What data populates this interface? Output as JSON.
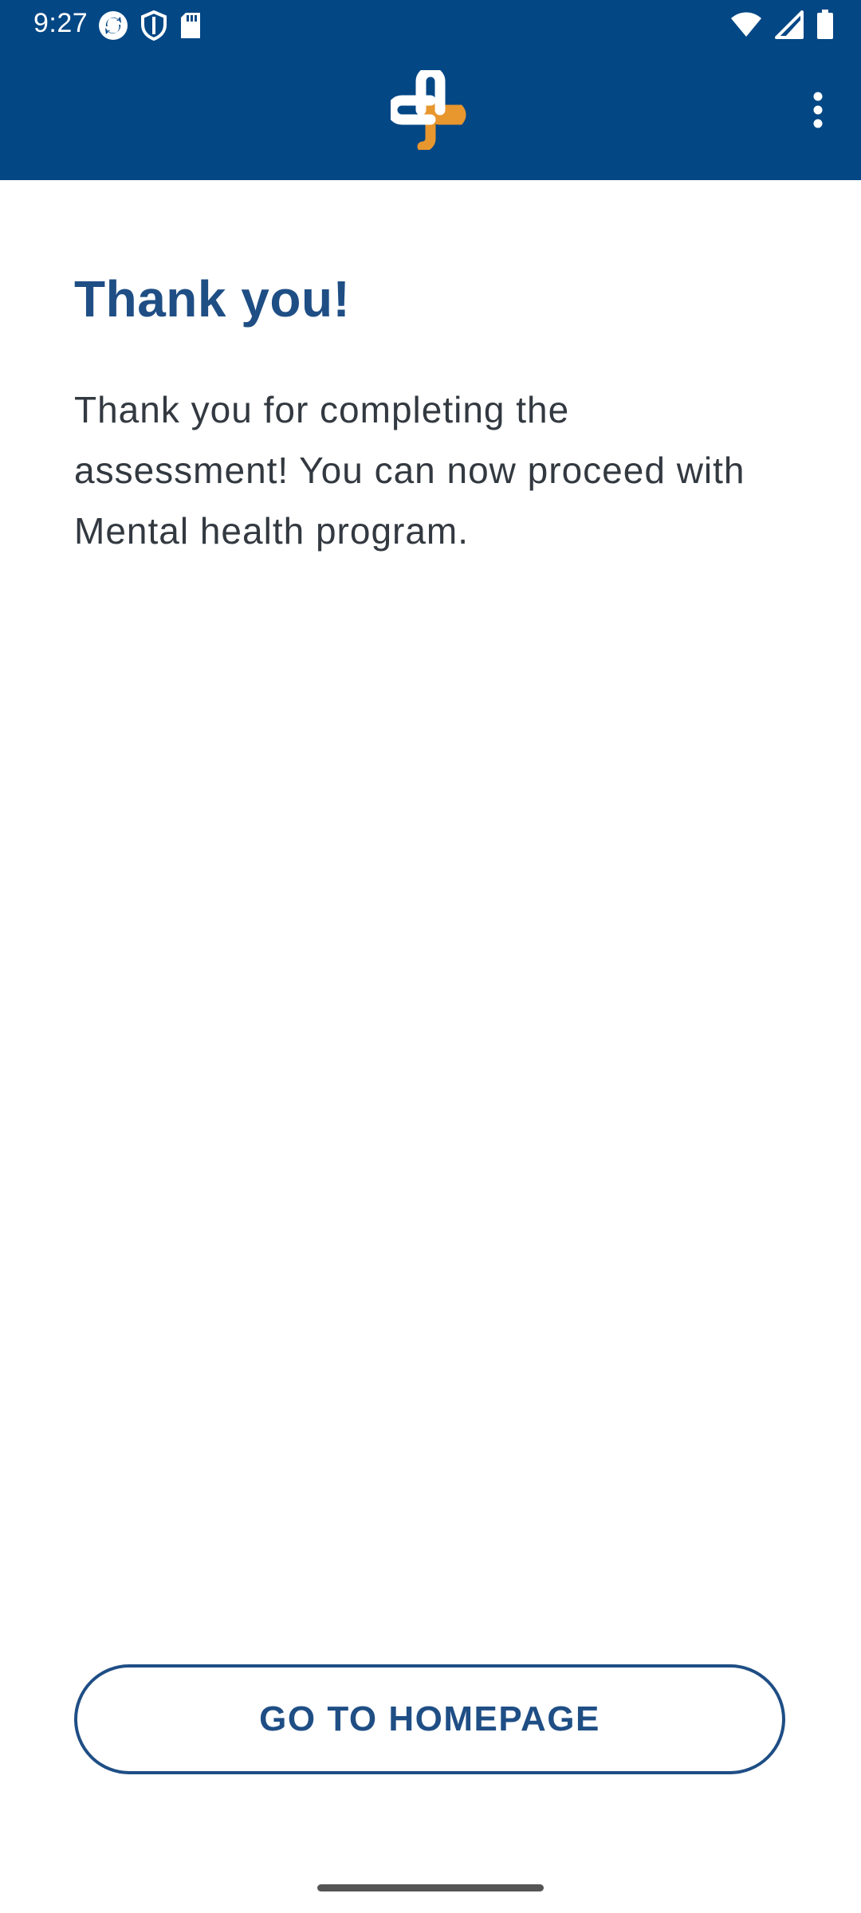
{
  "status_bar": {
    "time": "9:27",
    "left_icons": [
      "sync-icon",
      "shield-icon",
      "sd-card-icon"
    ],
    "right_icons": [
      "wifi-icon",
      "signal-icon",
      "battery-icon"
    ]
  },
  "app_bar": {
    "logo": "app-logo-cross",
    "menu_icon": "more-vertical-icon"
  },
  "main": {
    "title": "Thank you!",
    "message": "Thank you for completing the assessment! You can now proceed with Mental health program."
  },
  "actions": {
    "home_button_label": "GO TO HOMEPAGE"
  },
  "colors": {
    "app_bar_background": "#034785",
    "title": "#1f4e85",
    "logo_white": "#ffffff",
    "logo_orange": "#e8962e",
    "button_border": "#1f4e85",
    "body_text": "#333940"
  }
}
